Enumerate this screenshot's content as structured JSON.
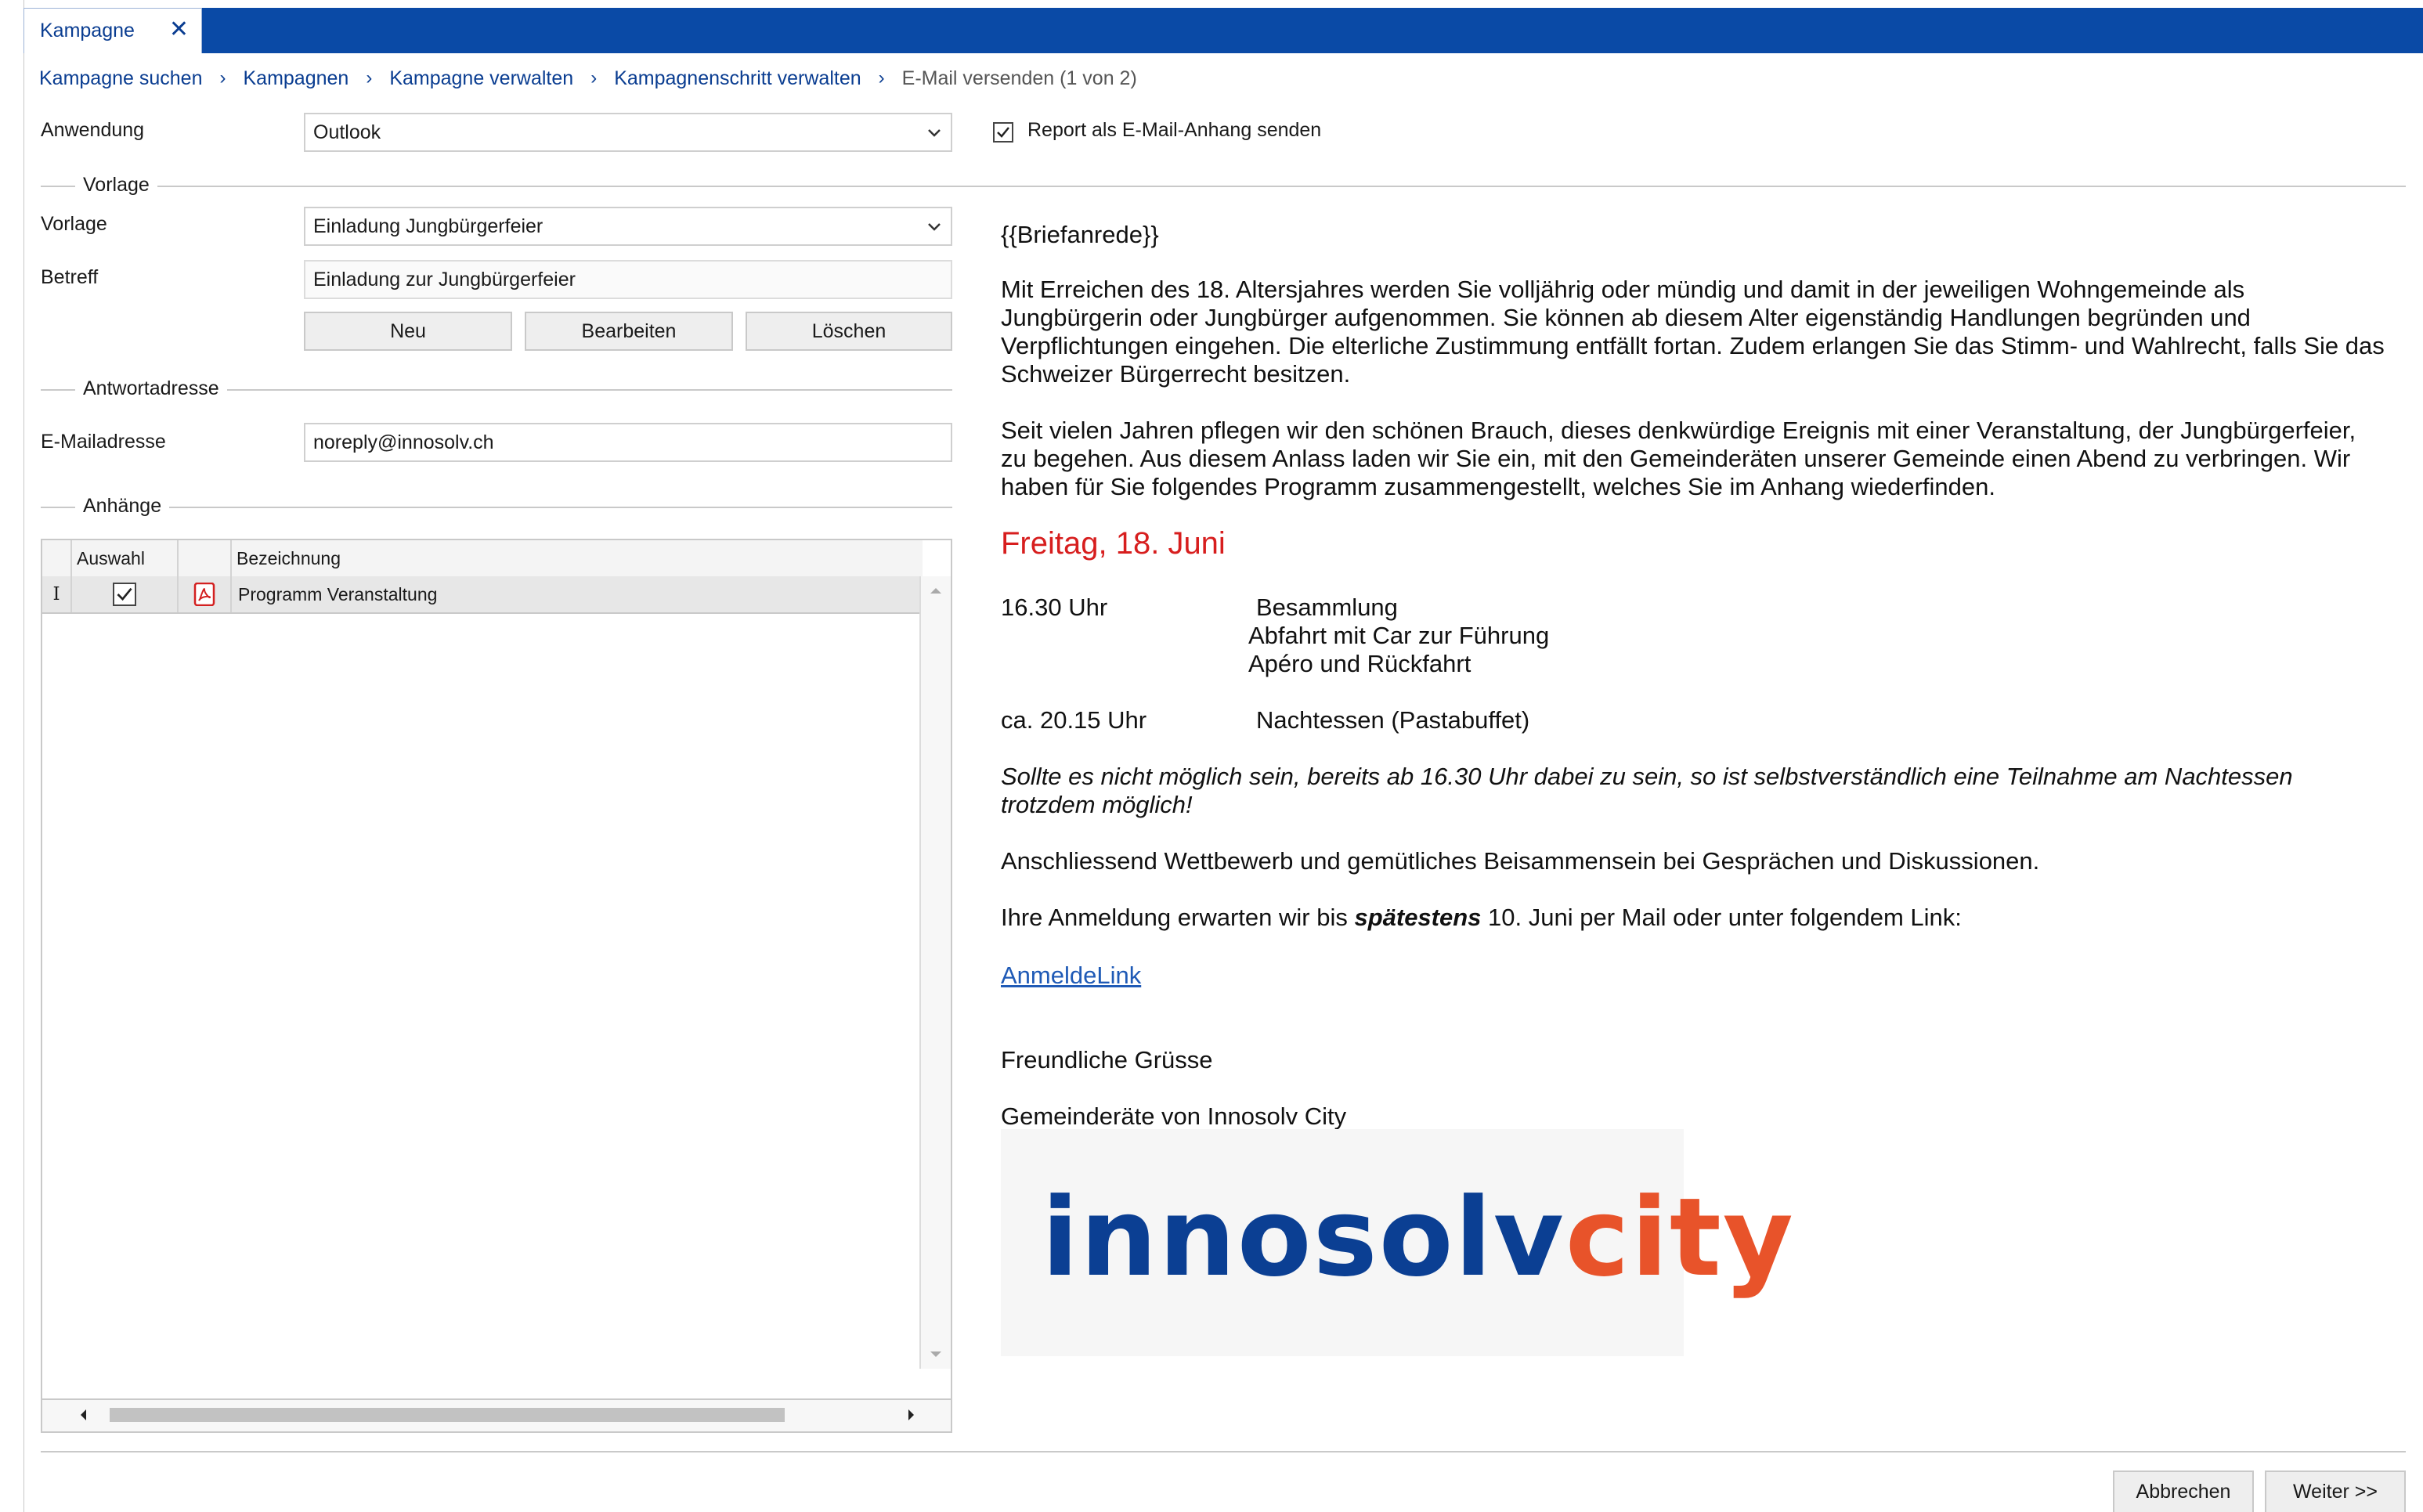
{
  "window": {
    "tab_title": "Kampagne",
    "tab_close": "✕"
  },
  "breadcrumb": {
    "items": [
      "Kampagne suchen",
      "Kampagnen",
      "Kampagne verwalten",
      "Kampagnenschritt verwalten"
    ],
    "current": "E-Mail versenden (1 von 2)",
    "separator": "›"
  },
  "form": {
    "anwendung_label": "Anwendung",
    "anwendung_value": "Outlook",
    "report_checkbox_label": "Report als E-Mail-Anhang senden",
    "report_checked": true,
    "vorlage_group": "Vorlage",
    "vorlage_label": "Vorlage",
    "vorlage_value": "Einladung Jungbürgerfeier",
    "betreff_label": "Betreff",
    "betreff_value": "Einladung zur Jungbürgerfeier",
    "btn_neu": "Neu",
    "btn_bearbeiten": "Bearbeiten",
    "btn_loeschen": "Löschen",
    "antwort_group": "Antwortadresse",
    "email_label": "E-Mailadresse",
    "email_value": "noreply@innosolv.ch",
    "anhaenge_group": "Anhänge"
  },
  "attachments": {
    "headers": {
      "auswahl": "Auswahl",
      "bezeichnung": "Bezeichnung"
    },
    "rows": [
      {
        "selected": true,
        "type_icon": "pdf-icon",
        "name": "Programm Veranstaltung",
        "row_marker": "I"
      }
    ]
  },
  "mail": {
    "salutation": "{{Briefanrede}}",
    "p1": "Mit Erreichen des 18. Altersjahres werden Sie volljährig oder mündig und damit in der jeweiligen Wohngemeinde als Jungbürgerin oder Jungbürger aufgenommen. Sie können ab diesem Alter eigenständig Handlungen begründen und Verpflichtungen eingehen. Die elterliche Zustimmung entfällt fortan. Zudem erlangen Sie das Stimm- und Wahlrecht, falls Sie das Schweizer Bürgerrecht besitzen.",
    "p2": "Seit vielen Jahren pflegen wir den schönen Brauch, dieses denkwürdige Ereignis mit einer Veranstaltung, der Jungbürgerfeier, zu begehen. Aus diesem Anlass laden wir Sie ein, mit den Gemeinderäten unserer Gemeinde einen Abend zu verbringen. Wir haben für Sie folgendes Programm zusammengestellt, welches Sie im Anhang wiederfinden.",
    "date_heading": "Freitag, 18. Juni",
    "time1": "16.30 Uhr",
    "item1": "Besammlung",
    "item2": "Abfahrt mit Car zur Führung",
    "item3": "Apéro und Rückfahrt",
    "time2": "ca. 20.15 Uhr",
    "item4": "Nachtessen (Pastabuffet)",
    "note": "Sollte es nicht möglich sein, bereits ab 16.30 Uhr dabei zu sein, so ist selbstverständlich eine Teilnahme am Nachtessen trotzdem möglich!",
    "p3": "Anschliessend Wettbewerb und gemütliches Beisammensein bei Gesprächen und Diskussionen.",
    "p4_before": "Ihre Anmeldung erwarten wir bis",
    "p4_bold": "spätestens",
    "p4_after": "10. Juni per Mail oder unter folgendem Link:",
    "link": "AnmeldeLink",
    "greeting": "Freundliche Grüsse",
    "signature": "Gemeinderäte von Innosolv City",
    "logo_part1": "innosolv",
    "logo_part2": "city"
  },
  "footer": {
    "cancel": "Abbrechen",
    "next": "Weiter >>"
  },
  "colors": {
    "tab_bar": "#0a4aa6",
    "link": "#0a3d91",
    "date_red": "#d71e1e",
    "logo_blue": "#0b3f93",
    "logo_orange": "#e8532a"
  }
}
